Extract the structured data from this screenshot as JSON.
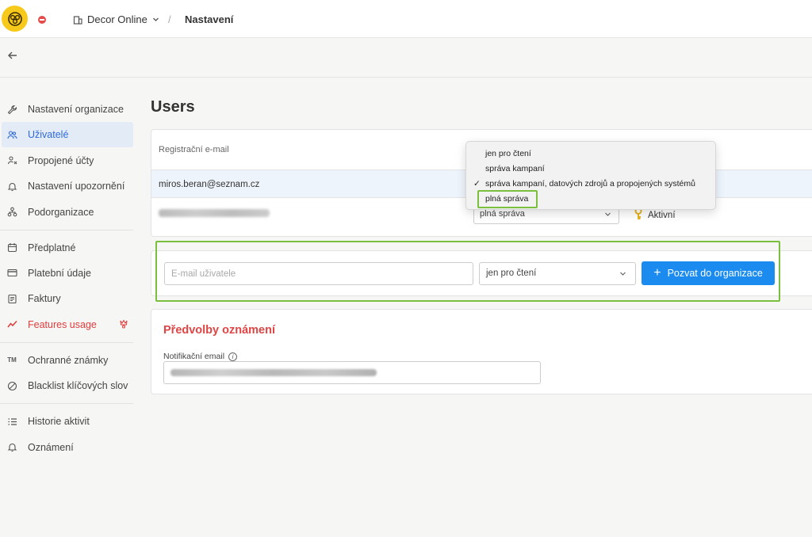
{
  "topbar": {
    "org_name": "Decor Online",
    "breadcrumb_sep": "/",
    "breadcrumb_current": "Nastavení"
  },
  "sidebar": {
    "items": [
      {
        "label": "Nastavení organizace",
        "icon": "wrench-icon"
      },
      {
        "label": "Uživatelé",
        "icon": "users-icon",
        "active": true
      },
      {
        "label": "Propojené účty",
        "icon": "user-link-icon"
      },
      {
        "label": "Nastavení upozornění",
        "icon": "bell-settings-icon"
      },
      {
        "label": "Podorganizace",
        "icon": "sitemap-icon"
      },
      {
        "label": "Předplatné",
        "icon": "calendar-icon"
      },
      {
        "label": "Platební údaje",
        "icon": "credit-card-icon"
      },
      {
        "label": "Faktury",
        "icon": "invoice-icon"
      },
      {
        "label": "Features usage",
        "icon": "trend-icon"
      },
      {
        "label": "Ochranné známky",
        "icon": "trademark-icon"
      },
      {
        "label": "Blacklist klíčových slov",
        "icon": "blocked-icon"
      },
      {
        "label": "Historie aktivit",
        "icon": "list-icon"
      },
      {
        "label": "Oznámení",
        "icon": "bell-icon"
      }
    ]
  },
  "page_title": "Users",
  "users_table": {
    "column_header": "Registrační e-mail",
    "rows": [
      {
        "email": "miros.beran@seznam.cz"
      },
      {
        "role": "plná správa",
        "status": "Aktivní"
      }
    ]
  },
  "role_dropdown": {
    "options": [
      "jen pro čtení",
      "správa kampaní",
      "správa kampaní, datových zdrojů a propojených systémů",
      "plná správa"
    ],
    "checked_index": 2
  },
  "invite": {
    "email_placeholder": "E-mail uživatele",
    "role_value": "jen pro čtení",
    "button_label": "Pozvat do organizace"
  },
  "preferences": {
    "title": "Předvolby oznámení",
    "notif_label": "Notifikační email"
  },
  "colors": {
    "accent": "#1b8bf0",
    "highlight": "#7bbf3f",
    "danger": "#e04545",
    "logo": "#f7c91b"
  }
}
